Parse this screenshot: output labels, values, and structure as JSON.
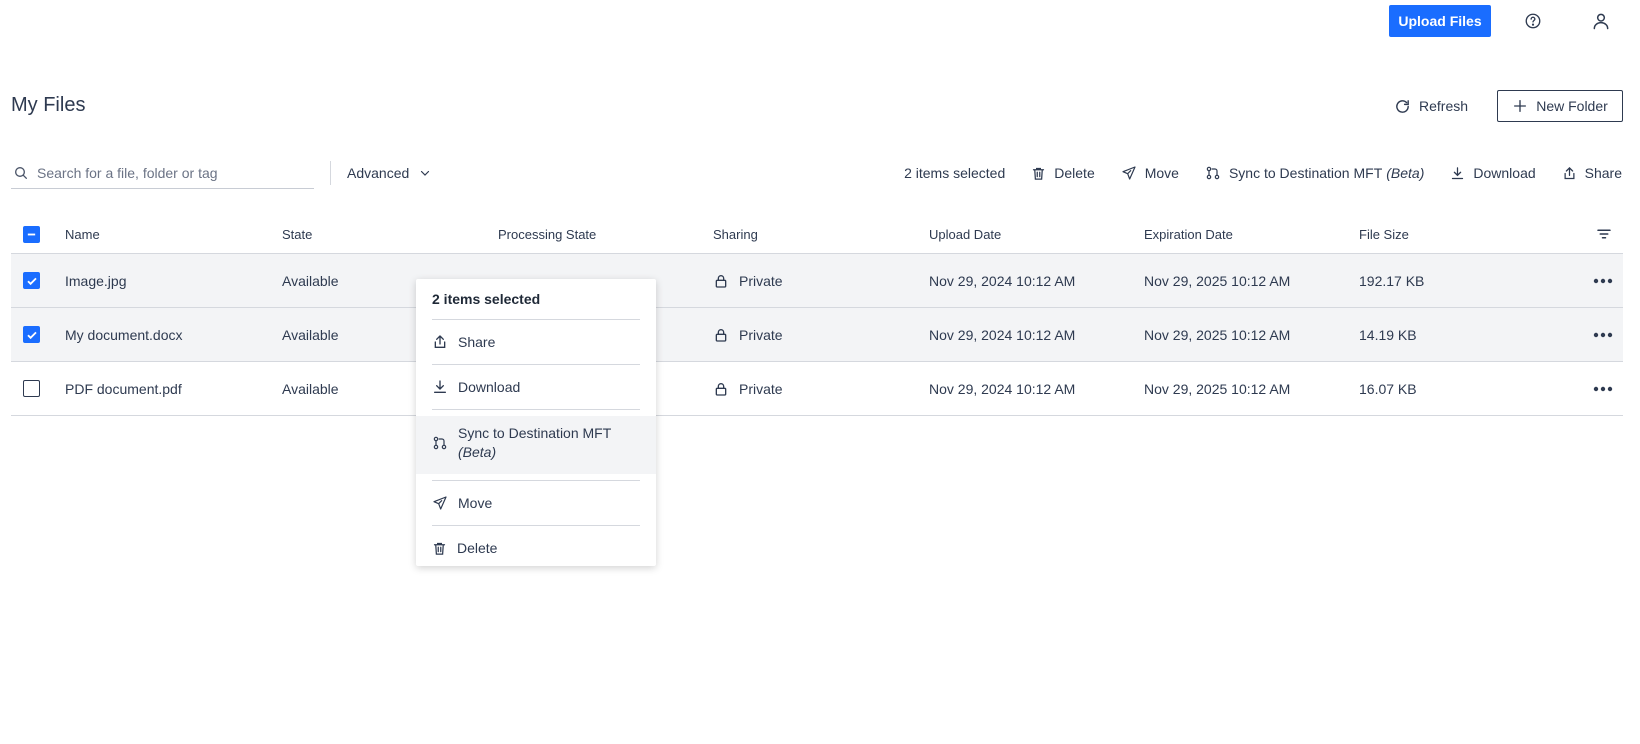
{
  "header": {
    "upload_label": "Upload Files",
    "help_icon": "help-circle-icon",
    "user_icon": "user-icon"
  },
  "page": {
    "title": "My Files",
    "refresh_label": "Refresh",
    "new_folder_label": "New Folder"
  },
  "toolbar": {
    "search_placeholder": "Search for a file, folder or tag",
    "advanced_label": "Advanced",
    "selected_count": "2 items selected",
    "actions": {
      "delete": "Delete",
      "move": "Move",
      "sync": "Sync to Destination MFT",
      "sync_beta": "(Beta)",
      "download": "Download",
      "share": "Share"
    }
  },
  "table": {
    "columns": {
      "name": "Name",
      "state": "State",
      "processing": "Processing State",
      "sharing": "Sharing",
      "upload": "Upload Date",
      "expiration": "Expiration Date",
      "size": "File Size"
    },
    "rows": [
      {
        "name": "Image.jpg",
        "state": "Available",
        "processing": "",
        "sharing": "Private",
        "upload": "Nov 29, 2024 10:12 AM",
        "expiration": "Nov 29, 2025 10:12 AM",
        "size": "192.17 KB",
        "checked": true
      },
      {
        "name": "My document.docx",
        "state": "Available",
        "processing": "",
        "sharing": "Private",
        "upload": "Nov 29, 2024 10:12 AM",
        "expiration": "Nov 29, 2025 10:12 AM",
        "size": "14.19 KB",
        "checked": true
      },
      {
        "name": "PDF document.pdf",
        "state": "Available",
        "processing": "",
        "sharing": "Private",
        "upload": "Nov 29, 2024 10:12 AM",
        "expiration": "Nov 29, 2025 10:12 AM",
        "size": "16.07 KB",
        "checked": false
      }
    ]
  },
  "context_menu": {
    "title": "2 items selected",
    "share": "Share",
    "download": "Download",
    "sync": "Sync to Destination MFT",
    "sync_beta": "(Beta)",
    "move": "Move",
    "delete": "Delete"
  },
  "colors": {
    "accent": "#1a6dff",
    "text": "#2e3a50",
    "selected_row": "#f3f4f6"
  }
}
